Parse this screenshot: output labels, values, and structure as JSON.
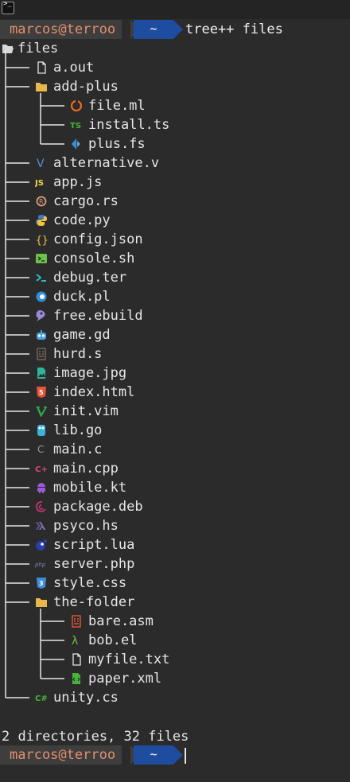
{
  "prompt": {
    "user": "marcos@terroo",
    "dir": "~",
    "command": "tree++ files"
  },
  "root": {
    "name": "files",
    "icon": "folder-open-icon"
  },
  "entries": [
    {
      "name": "a.out",
      "icon": "file-icon",
      "color": "#e6e6e6"
    },
    {
      "name": "add-plus",
      "icon": "folder-icon",
      "color": "#e8b64a"
    },
    {
      "name": "file.ml",
      "icon": "ocaml-icon",
      "color": "#ee6a1a"
    },
    {
      "name": "install.ts",
      "icon": "typescript-icon",
      "color": "#46b43a"
    },
    {
      "name": "plus.fs",
      "icon": "fsharp-icon",
      "color": "#3c8fd6"
    },
    {
      "name": "alternative.v",
      "icon": "vlang-icon",
      "color": "#5b8cd6"
    },
    {
      "name": "app.js",
      "icon": "javascript-icon",
      "color": "#f0d84a"
    },
    {
      "name": "cargo.rs",
      "icon": "rust-icon",
      "color": "#e0a07a"
    },
    {
      "name": "code.py",
      "icon": "python-icon",
      "color": "#3f7ac4"
    },
    {
      "name": "config.json",
      "icon": "json-icon",
      "color": "#e8c24a"
    },
    {
      "name": "console.sh",
      "icon": "shell-icon",
      "color": "#6bc24a"
    },
    {
      "name": "debug.ter",
      "icon": "terminal-icon",
      "color": "#32b6c8"
    },
    {
      "name": "duck.pl",
      "icon": "perl-icon",
      "color": "#2f8fd8"
    },
    {
      "name": "free.ebuild",
      "icon": "gentoo-icon",
      "color": "#9a8ad8"
    },
    {
      "name": "game.gd",
      "icon": "godot-icon",
      "color": "#4d9fdc"
    },
    {
      "name": "hurd.s",
      "icon": "assembly-icon",
      "color": "#7a6a5a"
    },
    {
      "name": "image.jpg",
      "icon": "image-icon",
      "color": "#2fb39a"
    },
    {
      "name": "index.html",
      "icon": "html-icon",
      "color": "#e8543a"
    },
    {
      "name": "init.vim",
      "icon": "vim-icon",
      "color": "#2fa84a"
    },
    {
      "name": "lib.go",
      "icon": "go-icon",
      "color": "#3cb4d8"
    },
    {
      "name": "main.c",
      "icon": "c-icon",
      "color": "#9a9a9a"
    },
    {
      "name": "main.cpp",
      "icon": "cpp-icon",
      "color": "#e0457a"
    },
    {
      "name": "mobile.kt",
      "icon": "android-icon",
      "color": "#9a5ad8"
    },
    {
      "name": "package.deb",
      "icon": "debian-icon",
      "color": "#d8357a"
    },
    {
      "name": "psyco.hs",
      "icon": "haskell-icon",
      "color": "#7d6bb0"
    },
    {
      "name": "script.lua",
      "icon": "lua-icon",
      "color": "#2a3fa8"
    },
    {
      "name": "server.php",
      "icon": "php-icon",
      "color": "#7a86c0"
    },
    {
      "name": "style.css",
      "icon": "css-icon",
      "color": "#3c8fd6"
    },
    {
      "name": "the-folder",
      "icon": "folder-icon",
      "color": "#e8b64a"
    },
    {
      "name": "bare.asm",
      "icon": "assembly-icon",
      "color": "#e8543a"
    },
    {
      "name": "bob.el",
      "icon": "lambda-icon",
      "color": "#6bc24a"
    },
    {
      "name": "myfile.txt",
      "icon": "file-icon",
      "color": "#e6e6e6"
    },
    {
      "name": "paper.xml",
      "icon": "xml-icon",
      "color": "#46b43a"
    },
    {
      "name": "unity.cs",
      "icon": "csharp-icon",
      "color": "#46b43a"
    }
  ],
  "summary": "2 directories, 32 files",
  "prompt2": {
    "user": "marcos@terroo",
    "dir": "~"
  }
}
